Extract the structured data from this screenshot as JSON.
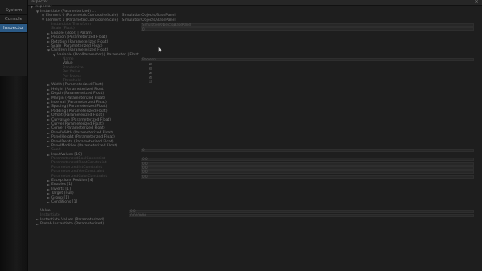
{
  "sidebar": {
    "items": [
      {
        "label": "System",
        "active": false
      },
      {
        "label": "Console",
        "active": false
      },
      {
        "label": "Inspector",
        "active": true
      }
    ]
  },
  "window": {
    "title": "Inspector",
    "close_label": "×"
  },
  "tree": {
    "rows": [
      {
        "label": "Inspector",
        "indent": 0,
        "arrow": "▼"
      },
      {
        "label": "Instantiate (Parameterized) ...",
        "indent": 1,
        "arrow": "▼"
      },
      {
        "label": "Element 0 (ParametricCompositeScale) | SimulationObjects/BasePanel",
        "indent": 2,
        "arrow": "▼"
      },
      {
        "label": "Element 1 (ParametricCompositeScale) | SimulationObjects/BasePanel",
        "indent": 2,
        "arrow": "▼"
      },
      {
        "label": "Instantiate Transform",
        "indent": 3,
        "arrow": "",
        "dim": true,
        "value": "SimulationObjects/BasePanel"
      },
      {
        "label": "Scale (Float)",
        "indent": 3,
        "arrow": "",
        "dim": true,
        "value": "0"
      },
      {
        "label": "Enable (Bool) | Param",
        "indent": 3,
        "arrow": "►"
      },
      {
        "label": "Position (Parameterized Float)",
        "indent": 3,
        "arrow": "►"
      },
      {
        "label": "Rotation (Parameterized Float)",
        "indent": 3,
        "arrow": "►"
      },
      {
        "label": "Scale (Parameterized Float)",
        "indent": 3,
        "arrow": "►"
      },
      {
        "label": "Children (Parameterized Float)",
        "indent": 3,
        "arrow": "▼"
      },
      {
        "label": "Variable (BoolParameter) | Parameter | Float",
        "indent": 4,
        "arrow": "▼"
      },
      {
        "label": "Name",
        "indent": 5,
        "arrow": "",
        "dim": true,
        "value": "Boolean"
      },
      {
        "label": "Value",
        "indent": 5,
        "arrow": "",
        "checkbox": true,
        "checked": true
      },
      {
        "label": "Randomize",
        "indent": 5,
        "arrow": "",
        "dim": true,
        "checkbox": true,
        "checked": true
      },
      {
        "label": "Per Value",
        "indent": 5,
        "arrow": "",
        "dim": true,
        "checkbox": true,
        "checked": true
      },
      {
        "label": "Per Frame",
        "indent": 5,
        "arrow": "",
        "dim": true,
        "checkbox": true,
        "checked": true
      },
      {
        "label": "Threshold",
        "indent": 5,
        "arrow": "",
        "dim": true,
        "checkbox": true,
        "checked": false
      },
      {
        "label": "Width (Parameterized Float)",
        "indent": 3,
        "arrow": "►"
      },
      {
        "label": "Height (Parameterized Float)",
        "indent": 3,
        "arrow": "►"
      },
      {
        "label": "Depth (Parameterized Float)",
        "indent": 3,
        "arrow": "►"
      },
      {
        "label": "Margin (Parameterized Float)",
        "indent": 3,
        "arrow": "►"
      },
      {
        "label": "Interval (Parameterized Float)",
        "indent": 3,
        "arrow": "►"
      },
      {
        "label": "Spacing (Parameterized Float)",
        "indent": 3,
        "arrow": "►"
      },
      {
        "label": "Padding (Parameterized Float)",
        "indent": 3,
        "arrow": "►"
      },
      {
        "label": "Offset (Parameterized Float)",
        "indent": 3,
        "arrow": "►"
      },
      {
        "label": "Curvature (Parameterized Float)",
        "indent": 3,
        "arrow": "►"
      },
      {
        "label": "Curve (Parameterized Float)",
        "indent": 3,
        "arrow": "►"
      },
      {
        "label": "Corner (Parameterized Float)",
        "indent": 3,
        "arrow": "►"
      },
      {
        "label": "PanelWidth (Parameterized Float)",
        "indent": 3,
        "arrow": "►"
      },
      {
        "label": "PanelHeight (Parameterized Float)",
        "indent": 3,
        "arrow": "►"
      },
      {
        "label": "PanelDepth (Parameterized Float)",
        "indent": 3,
        "arrow": "►"
      },
      {
        "label": "PanelModifier (Parameterized Float)",
        "indent": 3,
        "arrow": "►"
      },
      {
        "label": "Seed",
        "indent": 3,
        "arrow": "",
        "dim": true,
        "value": "0"
      },
      {
        "label": "InputValues [10]",
        "indent": 3,
        "arrow": "►"
      },
      {
        "label": "ParameterizedBoolConstraint",
        "indent": 3,
        "arrow": "",
        "dim": true,
        "value": "0.0"
      },
      {
        "label": "ParameterizedFloatConstraint",
        "indent": 3,
        "arrow": "",
        "dim": true,
        "value": "0.0"
      },
      {
        "label": "ParameterizedIntConstraint",
        "indent": 3,
        "arrow": "",
        "dim": true,
        "value": "0.0"
      },
      {
        "label": "ParameterizedVecConstraint",
        "indent": 3,
        "arrow": "",
        "dim": true,
        "value": "0.0"
      },
      {
        "label": "ParameterizedColorConstraint",
        "indent": 3,
        "arrow": "",
        "dim": true,
        "value": "0.0"
      },
      {
        "label": "Exceptions Position [4]",
        "indent": 3,
        "arrow": "►"
      },
      {
        "label": "Enables [1]",
        "indent": 3,
        "arrow": "►"
      },
      {
        "label": "Inverts [1]",
        "indent": 3,
        "arrow": "►"
      },
      {
        "label": "Target (null)",
        "indent": 3,
        "arrow": "►"
      },
      {
        "label": "Group [1]",
        "indent": 3,
        "arrow": "►"
      },
      {
        "label": "Conditions [1]",
        "indent": 3,
        "arrow": "►"
      },
      {
        "label": "",
        "indent": 0,
        "arrow": "",
        "blank": true
      },
      {
        "label": "Value",
        "indent": 1,
        "arrow": "",
        "value": "0.0"
      },
      {
        "label": "Instantiate",
        "indent": 1,
        "arrow": "",
        "dim": true,
        "value": "0.000000"
      },
      {
        "label": "Instantiate Values (Parameterized)",
        "indent": 1,
        "arrow": "►"
      },
      {
        "label": "Prefab Instantiate (Parameterized)",
        "indent": 1,
        "arrow": "►"
      }
    ]
  }
}
